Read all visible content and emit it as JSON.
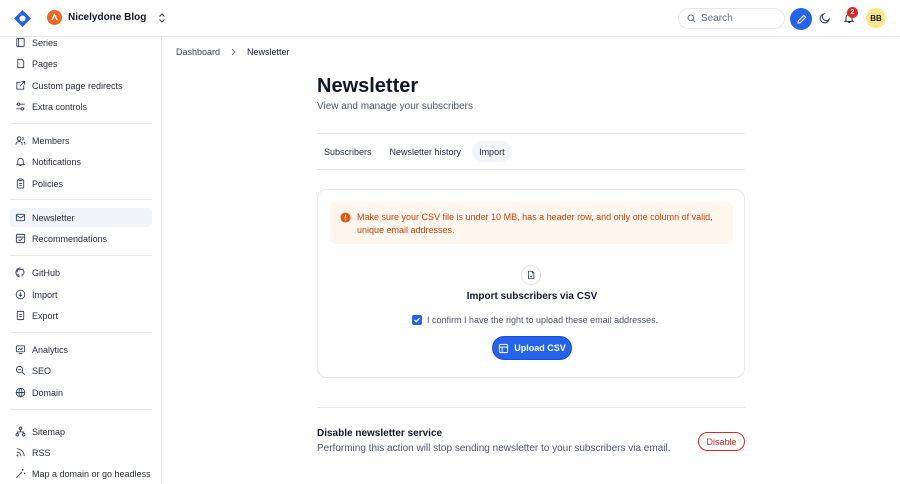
{
  "header": {
    "blog_name": "Nicelydone Blog",
    "search_placeholder": "Search",
    "notification_count": "2",
    "user_initials": "BB"
  },
  "sidebar": {
    "items": [
      {
        "label": "Series",
        "icon": "book-icon"
      },
      {
        "label": "Pages",
        "icon": "file-icon"
      },
      {
        "label": "Custom page redirects",
        "icon": "external-link-icon"
      },
      {
        "label": "Extra controls",
        "icon": "sliders-icon"
      },
      {
        "label": "Members",
        "icon": "users-icon"
      },
      {
        "label": "Notifications",
        "icon": "bell-icon"
      },
      {
        "label": "Policies",
        "icon": "clipboard-icon"
      },
      {
        "label": "Newsletter",
        "icon": "mail-icon",
        "active": true
      },
      {
        "label": "Recommendations",
        "icon": "recommend-icon"
      },
      {
        "label": "GitHub",
        "icon": "github-icon"
      },
      {
        "label": "Import",
        "icon": "import-icon"
      },
      {
        "label": "Export",
        "icon": "export-icon"
      },
      {
        "label": "Analytics",
        "icon": "chart-icon"
      },
      {
        "label": "SEO",
        "icon": "seo-icon"
      },
      {
        "label": "Domain",
        "icon": "globe-icon"
      },
      {
        "label": "Sitemap",
        "icon": "sitemap-icon"
      },
      {
        "label": "RSS",
        "icon": "rss-icon"
      },
      {
        "label": "Map a domain or go headless",
        "icon": "wand-icon"
      }
    ]
  },
  "breadcrumb": {
    "parent": "Dashboard",
    "current": "Newsletter"
  },
  "page": {
    "title": "Newsletter",
    "subtitle": "View and manage your subscribers"
  },
  "tabs": [
    {
      "label": "Subscribers"
    },
    {
      "label": "Newsletter history"
    },
    {
      "label": "Import",
      "active": true
    }
  ],
  "import_card": {
    "alert": "Make sure your CSV file is under 10 MB, has a header row, and only one column of valid, unique email addresses.",
    "title": "Import subscribers via CSV",
    "confirm_label": "I confirm I have the right to upload these email addresses.",
    "confirm_checked": true,
    "upload_label": "Upload CSV"
  },
  "disable_section": {
    "title": "Disable newsletter service",
    "text": "Performing this action will stop sending newsletter to your subscribers via email.",
    "button_label": "Disable"
  },
  "colors": {
    "accent": "#2563eb",
    "warning_bg": "#fff7ed",
    "warning_text": "#c2410c",
    "danger": "#dc2626",
    "brand": "#f26522"
  }
}
